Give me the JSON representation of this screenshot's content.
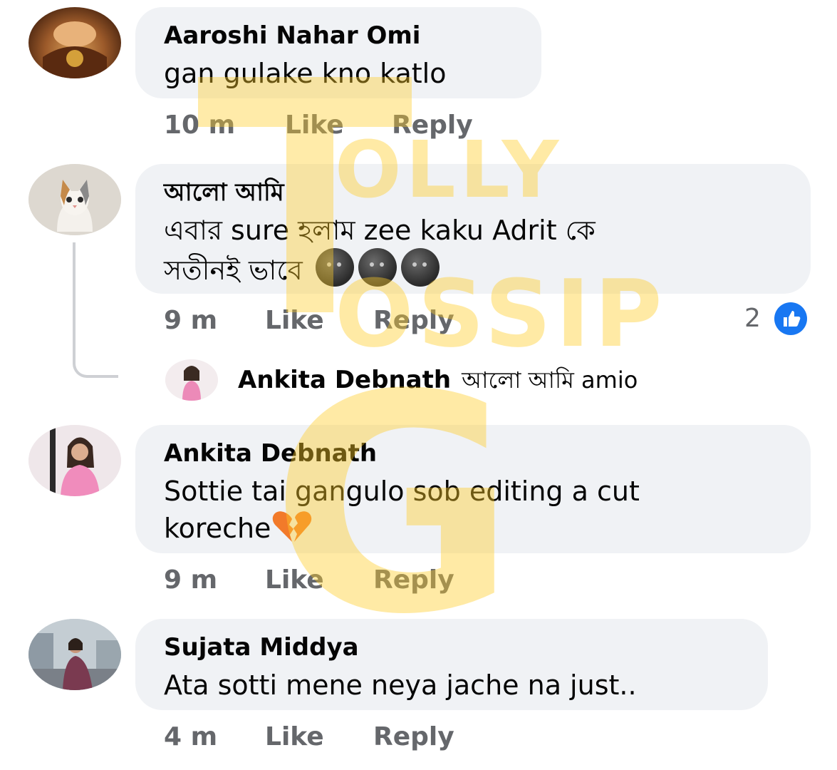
{
  "comments": [
    {
      "author": "Aaroshi Nahar Omi",
      "text": "gan gulake kno katlo",
      "time": "10 m",
      "like_label": "Like",
      "reply_label": "Reply"
    },
    {
      "author": "আলো আমি",
      "text_line1": "এবার sure হলাম zee kaku Adrit কে",
      "text_line2": "সতীনই ভাবে",
      "time": "9 m",
      "like_label": "Like",
      "reply_label": "Reply",
      "reaction_count": "2",
      "reply": {
        "author": "Ankita Debnath",
        "text": "আলো আমি amio"
      }
    },
    {
      "author": "Ankita Debnath",
      "text_line1": "Sottie tai gangulo sob editing a cut",
      "text_line2": "koreche",
      "time": "9 m",
      "like_label": "Like",
      "reply_label": "Reply"
    },
    {
      "author": "Sujata Middya",
      "text": "Ata sotti mene neya jache na just..",
      "time": "4 m",
      "like_label": "Like",
      "reply_label": "Reply"
    }
  ],
  "watermark": {
    "big_letter": "G",
    "word1": "OLLY",
    "word2": "OSSIP"
  },
  "colors": {
    "bubble": "#f0f2f5",
    "meta": "#65676b",
    "like_badge": "#1877f2",
    "watermark": "#ffce28"
  }
}
